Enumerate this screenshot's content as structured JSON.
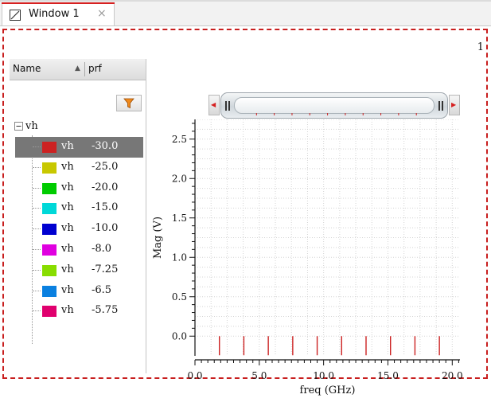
{
  "tab": {
    "label": "Window 1",
    "close_glyph": "×",
    "icon": "waveform-window-icon"
  },
  "frame_number": "1",
  "tree": {
    "columns": {
      "name": "Name",
      "prf": "prf"
    },
    "filter_icon": "filter-funnel-icon",
    "root": {
      "label": "vh",
      "expander_icon": "collapse-minus-icon"
    },
    "rows": [
      {
        "name": "vh",
        "prf": "-30.0",
        "color": "#cc2222",
        "selected": true
      },
      {
        "name": "vh",
        "prf": "-25.0",
        "color": "#c8c800",
        "selected": false
      },
      {
        "name": "vh",
        "prf": "-20.0",
        "color": "#00cc00",
        "selected": false
      },
      {
        "name": "vh",
        "prf": "-15.0",
        "color": "#00d8d8",
        "selected": false
      },
      {
        "name": "vh",
        "prf": "-10.0",
        "color": "#0000d0",
        "selected": false
      },
      {
        "name": "vh",
        "prf": "-8.0",
        "color": "#e000e0",
        "selected": false
      },
      {
        "name": "vh",
        "prf": "-7.25",
        "color": "#88dd00",
        "selected": false
      },
      {
        "name": "vh",
        "prf": "-6.5",
        "color": "#0a80e0",
        "selected": false
      },
      {
        "name": "vh",
        "prf": "-5.75",
        "color": "#e0006e",
        "selected": false
      }
    ]
  },
  "chart_data": {
    "type": "bar",
    "title": "",
    "xlabel": "freq (GHz)",
    "ylabel": "Mag (V)",
    "xlim": [
      0,
      20.6
    ],
    "ylim": [
      -0.25,
      2.75
    ],
    "x_ticks": [
      "0.0",
      "5.0",
      "10.0",
      "15.0",
      "20.0"
    ],
    "y_ticks": [
      "0.0",
      "0.5",
      "1.0",
      "1.5",
      "2.0",
      "2.5"
    ],
    "grid": true,
    "legend": "none",
    "series": [
      {
        "color": "#cc2222",
        "x": [
          1.9,
          3.8,
          5.7,
          7.6,
          9.5,
          11.4,
          13.3,
          15.2,
          17.1,
          19.0
        ],
        "y": [
          0.0,
          0.0,
          0.0,
          0.0,
          0.0,
          0.0,
          0.0,
          0.0,
          0.0,
          0.0
        ],
        "stem_top": 0.0
      }
    ]
  }
}
